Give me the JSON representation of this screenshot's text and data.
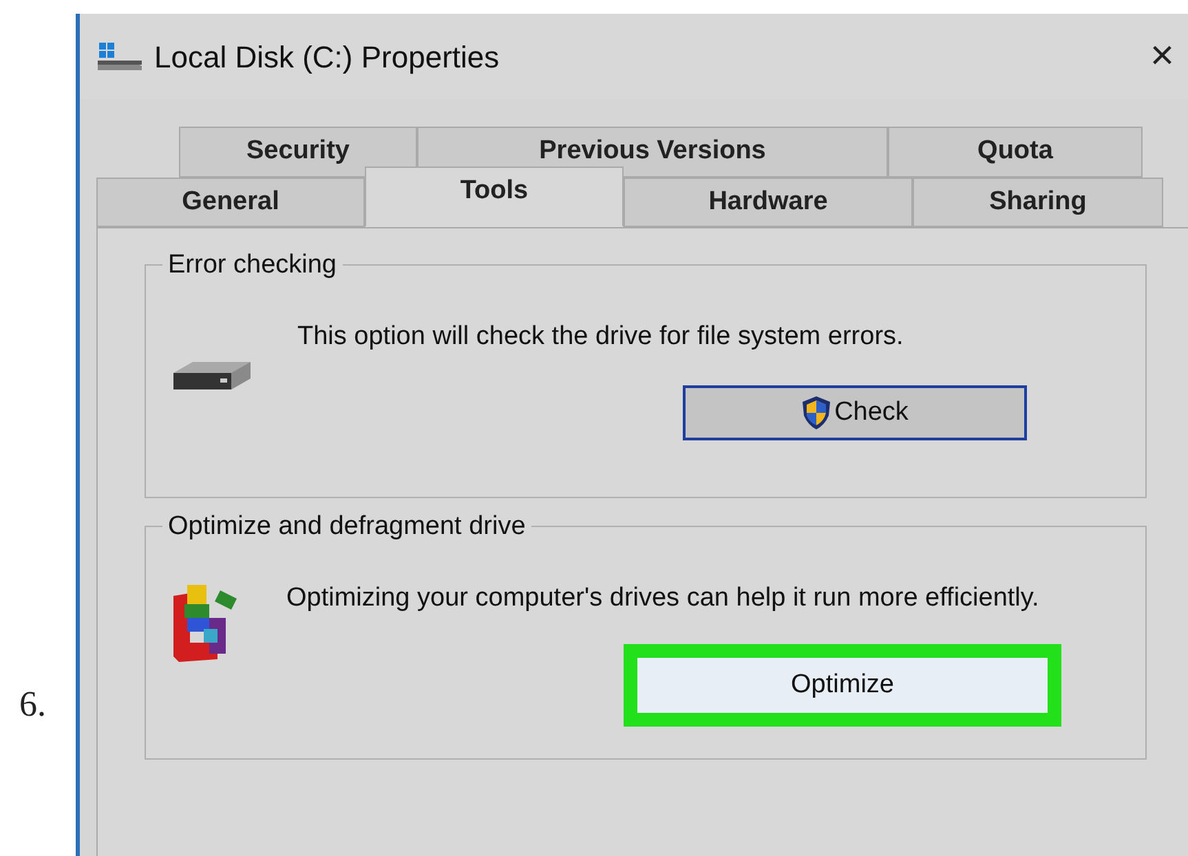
{
  "step_number": "6.",
  "window": {
    "title": "Local Disk (C:) Properties",
    "close": "×"
  },
  "tab_rows": [
    [
      {
        "label": "Security",
        "selected": false
      },
      {
        "label": "Previous Versions",
        "selected": false
      },
      {
        "label": "Quota",
        "selected": false
      }
    ],
    [
      {
        "label": "General",
        "selected": false
      },
      {
        "label": "Tools",
        "selected": true
      },
      {
        "label": "Hardware",
        "selected": false
      },
      {
        "label": "Sharing",
        "selected": false
      }
    ]
  ],
  "groups": [
    {
      "kind": "disk",
      "title": "Error checking",
      "text": "This option will check the drive for file system errors.",
      "button": {
        "label": "Check",
        "shield": true,
        "focused": true,
        "highlighted": false
      }
    },
    {
      "kind": "defrag",
      "title": "Optimize and defragment drive",
      "text": "Optimizing your computer's drives can help it run more efficiently.",
      "button": {
        "label": "Optimize",
        "shield": false,
        "focused": false,
        "highlighted": true
      }
    }
  ]
}
